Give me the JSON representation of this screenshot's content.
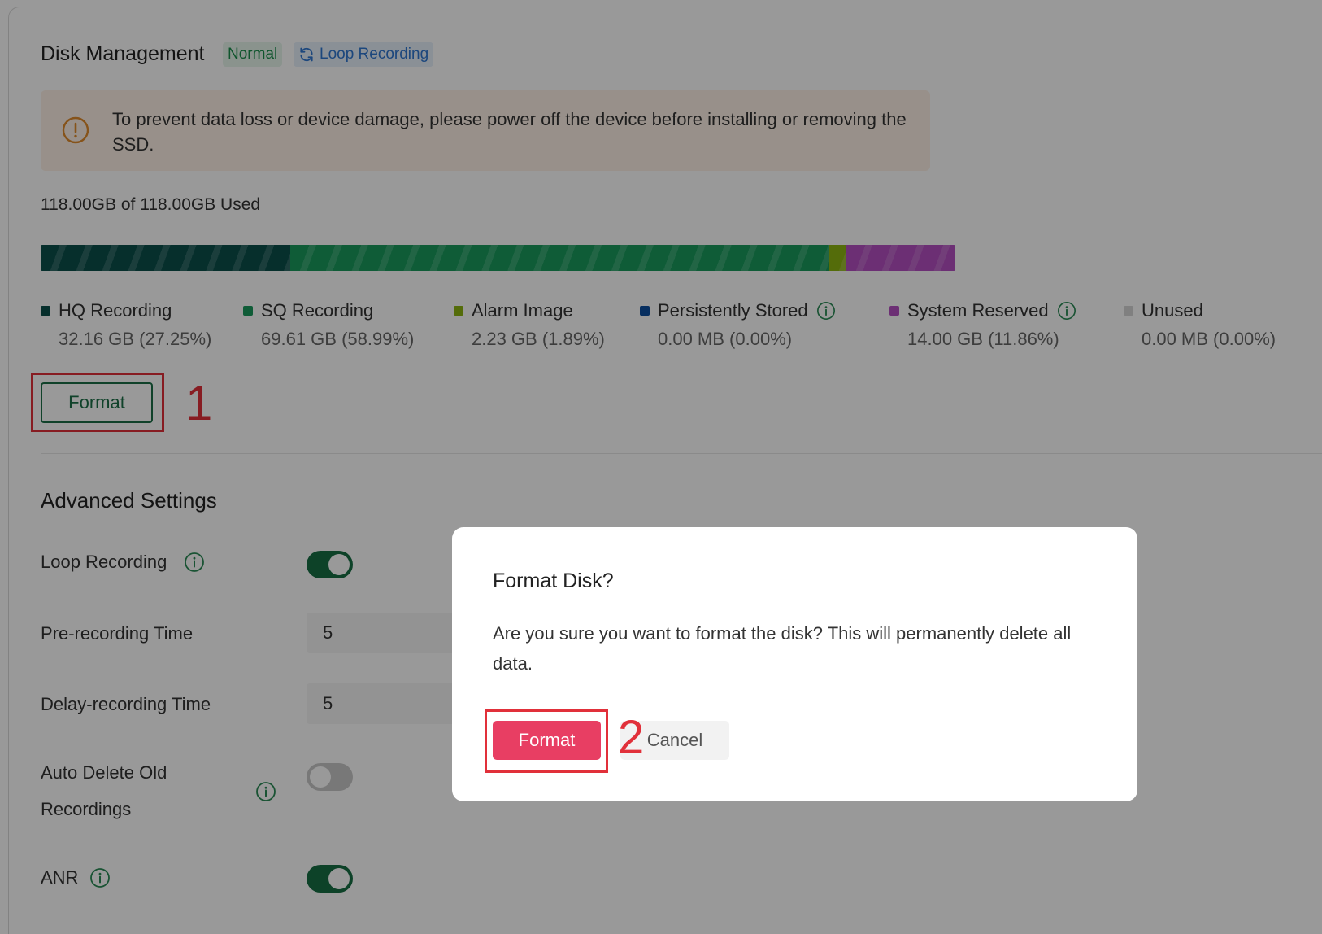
{
  "disk": {
    "title": "Disk Management",
    "status_tag": "Normal",
    "mode_tag": "Loop Recording",
    "alert_text": "To prevent data loss or device damage, please power off the device before installing or removing the SSD.",
    "usage_text": "118.00GB of 118.00GB Used",
    "segments": [
      {
        "name": "HQ Recording",
        "fraction": 0.2725,
        "color": "#0b4f4a"
      },
      {
        "name": "SQ Recording",
        "fraction": 0.5899,
        "color": "#1a9a5c"
      },
      {
        "name": "Alarm Image",
        "fraction": 0.0189,
        "color": "#8db512"
      },
      {
        "name": "Persistently Stored",
        "fraction": 0.0,
        "color": "#0c4fa0"
      },
      {
        "name": "System Reserved",
        "fraction": 0.1186,
        "color": "#b44fc1"
      },
      {
        "name": "Unused",
        "fraction": 0.0,
        "color": "#d6d6d6"
      }
    ],
    "legend": [
      {
        "label": "HQ Recording",
        "value": "32.16 GB (27.25%)",
        "color": "#0b4f4a"
      },
      {
        "label": "SQ Recording",
        "value": "69.61 GB (58.99%)",
        "color": "#1a9a5c"
      },
      {
        "label": "Alarm Image",
        "value": "2.23 GB (1.89%)",
        "color": "#8db512"
      },
      {
        "label": "Persistently Stored",
        "value": "0.00 MB (0.00%)",
        "color": "#0c4fa0"
      },
      {
        "label": "System Reserved",
        "value": "14.00 GB (11.86%)",
        "color": "#b44fc1"
      },
      {
        "label": "Unused",
        "value": "0.00 MB (0.00%)",
        "color": "#d6d6d6"
      }
    ],
    "format_button": "Format"
  },
  "annotations": {
    "step1": "1",
    "step2": "2"
  },
  "advanced": {
    "title": "Advanced Settings",
    "loop_recording_label": "Loop Recording",
    "pre_recording_label": "Pre-recording Time",
    "pre_recording_value": "5",
    "delay_recording_label": "Delay-recording Time",
    "delay_recording_value": "5",
    "auto_delete_label_line1": "Auto Delete Old",
    "auto_delete_label_line2": "Recordings",
    "anr_label": "ANR",
    "loop_recording_on": true,
    "auto_delete_on": false,
    "anr_on": true
  },
  "modal": {
    "title": "Format Disk?",
    "message": "Are you sure you want to format the disk? This will permanently delete all data.",
    "confirm_label": "Format",
    "cancel_label": "Cancel"
  },
  "colors": {
    "brand_green": "#176e43",
    "danger": "#e83e63",
    "annotation_red": "#e1303a"
  }
}
